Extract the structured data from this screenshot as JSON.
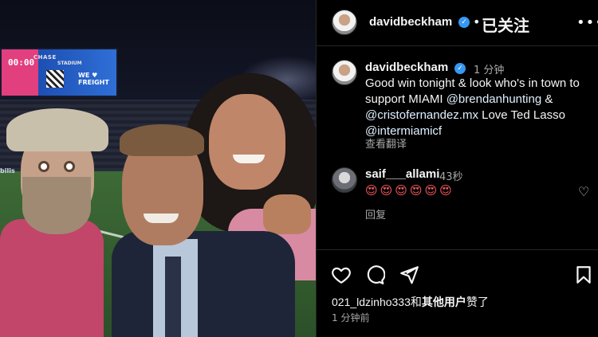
{
  "photo": {
    "scoreboard_time": "00:00",
    "scoreboard_we_text": "WE ♥ FREIGHT",
    "venue_chase": "CHASE",
    "venue_stadium": "STADIUM",
    "bank_sign": "bilis"
  },
  "header": {
    "username": "davidbeckham",
    "verified_icon": "verified-badge-icon",
    "follow_separator": "•",
    "follow_status": "已关注",
    "more_icon": "ellipsis-icon"
  },
  "caption": {
    "username": "davidbeckham",
    "time": "1 分钟",
    "text_part1": "Good win tonight & look who's in town to support MIAMI ",
    "mention1": "@brendanhunting",
    "text_part2": " & ",
    "mention2": "@cristofernandez.mx",
    "text_part3": " Love Ted Lasso ",
    "mention3": "@intermiamicf",
    "text_part4": " ",
    "translate": "查看翻译"
  },
  "comment": {
    "username": "saif___allami",
    "time": "43秒",
    "emojis": "😍😍😍😍😍😍",
    "reply": "回复",
    "like_icon": "heart-outline-icon"
  },
  "actions": {
    "like_icon": "heart-icon",
    "comment_icon": "comment-icon",
    "share_icon": "share-icon",
    "save_icon": "bookmark-icon",
    "likes_user": "021_ldzinho333",
    "likes_connector": "和",
    "likes_others": "其他用户",
    "likes_suffix": "赞了",
    "post_age": "1 分钟前"
  },
  "colors": {
    "background": "#000000",
    "text": "#f5f5f5",
    "muted": "#a8a8a8",
    "verified": "#3897f0",
    "divider": "#262626"
  }
}
